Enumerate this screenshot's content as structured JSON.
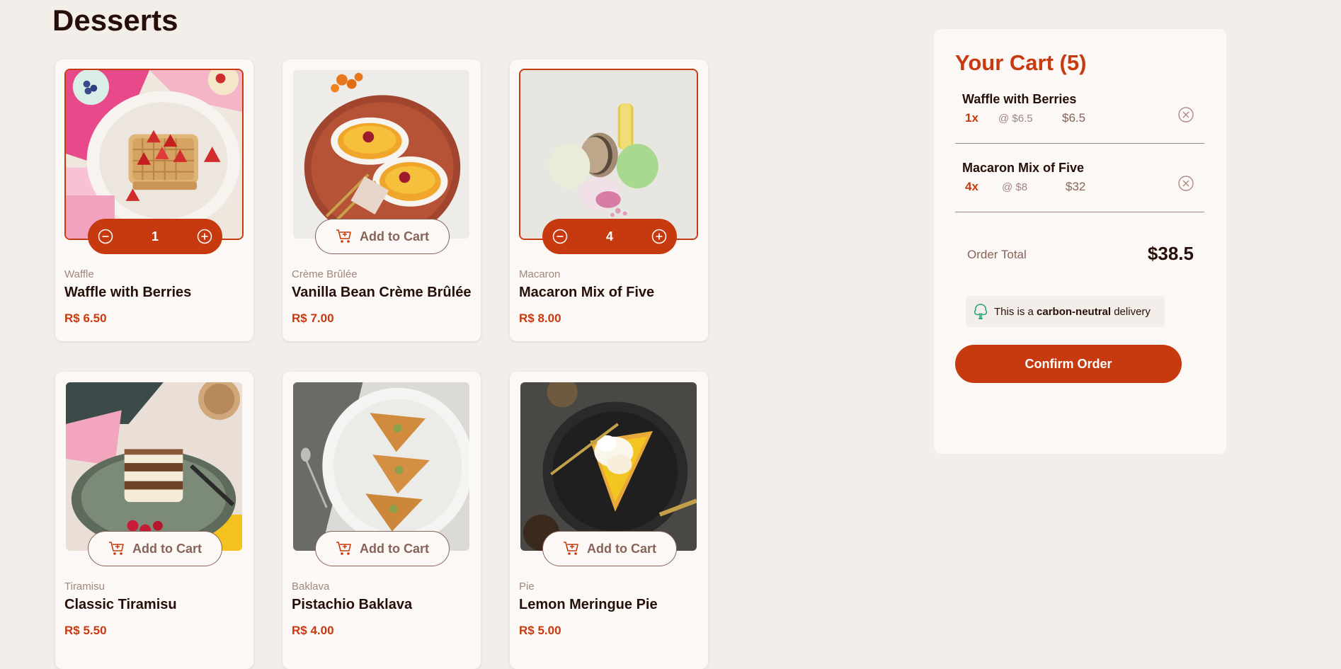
{
  "page": {
    "title": "Desserts"
  },
  "theme": {
    "accent": "#c73a0f",
    "text_dark": "#260f08",
    "text_muted": "#87635a",
    "text_light": "#a0877f",
    "page_bg": "#f4eeeb",
    "card_bg": "#fcf8f6",
    "carbon_green": "#1ea475"
  },
  "products": [
    {
      "category": "Waffle",
      "name": "Waffle with Berries",
      "price": "R$ 6.50",
      "quantity": "1",
      "in_cart": true,
      "image": "waffle-with-berries-photo"
    },
    {
      "category": "Crème Brûlée",
      "name": "Vanilla Bean Crème Brûlée",
      "price": "R$ 7.00",
      "add_label": "Add to Cart",
      "in_cart": false,
      "image": "creme-brulee-photo"
    },
    {
      "category": "Macaron",
      "name": "Macaron Mix of Five",
      "price": "R$ 8.00",
      "quantity": "4",
      "in_cart": true,
      "image": "macarons-photo"
    },
    {
      "category": "Tiramisu",
      "name": "Classic Tiramisu",
      "price": "R$ 5.50",
      "add_label": "Add to Cart",
      "in_cart": false,
      "image": "tiramisu-photo"
    },
    {
      "category": "Baklava",
      "name": "Pistachio Baklava",
      "price": "R$ 4.00",
      "add_label": "Add to Cart",
      "in_cart": false,
      "image": "baklava-photo"
    },
    {
      "category": "Pie",
      "name": "Lemon Meringue Pie",
      "price": "R$ 5.00",
      "add_label": "Add to Cart",
      "in_cart": false,
      "image": "lemon-meringue-pie-photo"
    }
  ],
  "cart": {
    "title": "Your Cart (5)",
    "items": [
      {
        "name": "Waffle with Berries",
        "quantity": "1x",
        "unit_price": "@ $6.5",
        "line_total": "$6.5"
      },
      {
        "name": "Macaron Mix of Five",
        "quantity": "4x",
        "unit_price": "@ $8",
        "line_total": "$32"
      }
    ],
    "order_total_label": "Order Total",
    "order_total_value": "$38.5",
    "carbon_prefix": "This is a",
    "carbon_bold": "carbon-neutral",
    "carbon_suffix": "delivery",
    "confirm_label": "Confirm Order"
  },
  "icons": {
    "add_to_cart": "cart-plus-icon",
    "decrement": "minus-circle-icon",
    "increment": "plus-circle-icon",
    "remove": "x-circle-icon",
    "carbon": "tree-icon"
  }
}
